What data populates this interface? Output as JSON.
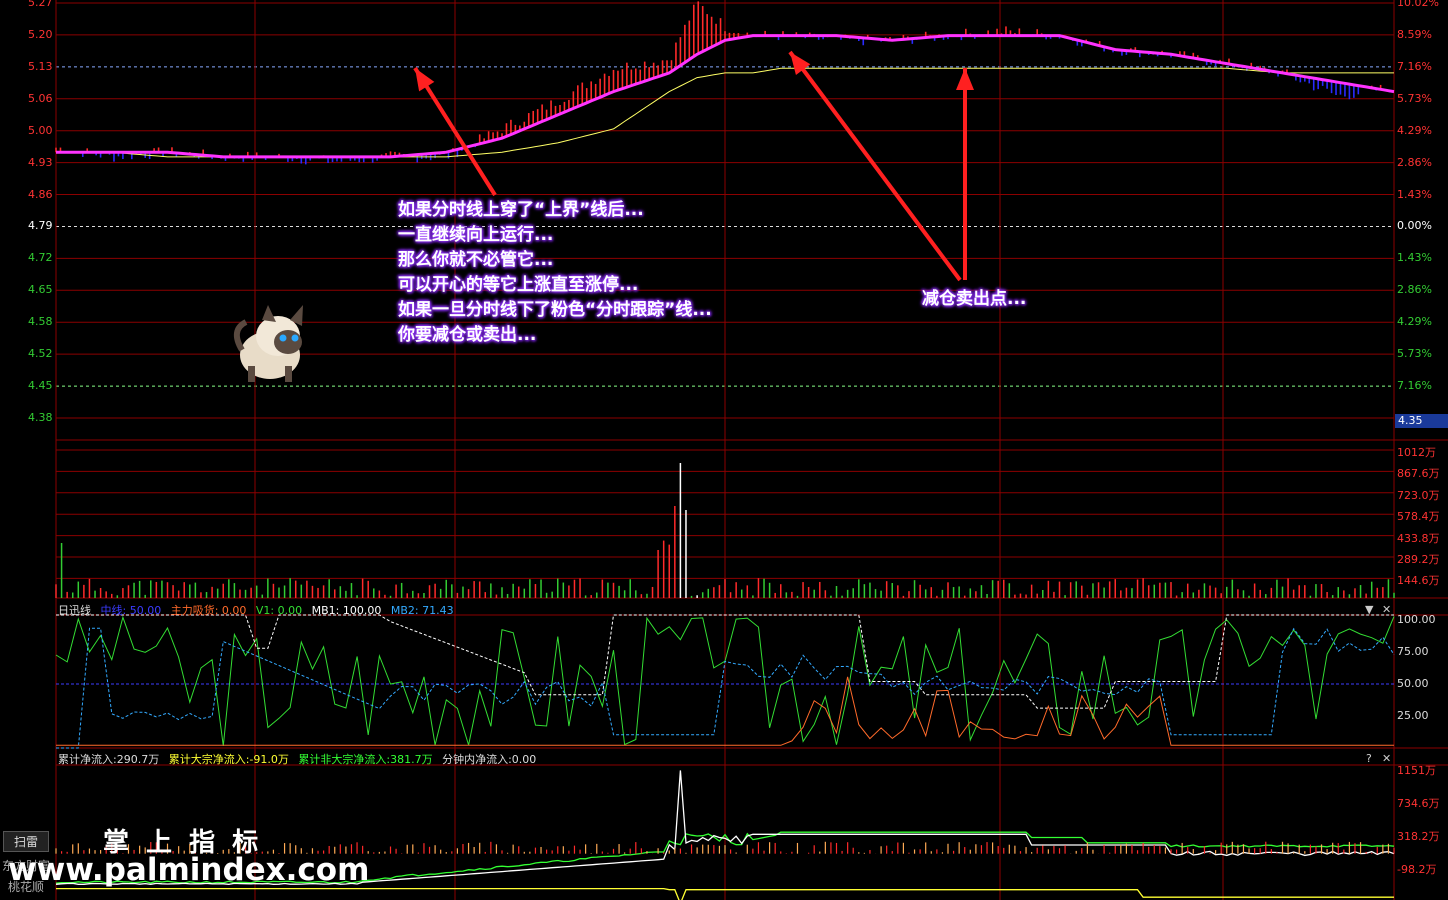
{
  "colors": {
    "up": "#ff2a2a",
    "down": "#2a2aff",
    "price_line": "#ffffff",
    "avg_line": "#ffff66",
    "track_line": "#ff33ff",
    "grid": "#8b0000",
    "green_label": "#33cc33",
    "red_label": "#ff3333",
    "annotation_arrow": "#ff2020"
  },
  "chart_data": [
    {
      "type": "line",
      "panel": "price",
      "ylim": [
        4.38,
        5.27
      ],
      "left_ticks": [
        "5.27",
        "5.20",
        "5.13",
        "5.06",
        "5.00",
        "4.93",
        "4.86",
        "4.79",
        "4.72",
        "4.65",
        "4.58",
        "4.52",
        "4.45",
        "4.38"
      ],
      "right_ticks": [
        "10.02%",
        "8.59%",
        "7.16%",
        "5.73%",
        "4.29%",
        "2.86%",
        "1.43%",
        "0.00%",
        "1.43%",
        "2.86%",
        "4.29%",
        "5.73%",
        "7.16%",
        ""
      ],
      "base_price": 4.79,
      "current_marker": "4.35",
      "x": [
        0,
        10,
        20,
        30,
        40,
        50,
        60,
        70,
        80,
        90,
        100,
        110,
        115,
        120,
        125,
        130,
        140,
        150,
        160,
        170,
        180,
        190,
        200,
        210,
        220,
        230,
        240
      ],
      "series": [
        {
          "key": "price",
          "values": [
            4.96,
            4.94,
            4.95,
            4.94,
            4.94,
            4.93,
            4.94,
            4.94,
            5.0,
            5.06,
            5.13,
            5.15,
            5.27,
            5.22,
            5.2,
            5.2,
            5.19,
            5.19,
            5.2,
            5.21,
            5.2,
            5.17,
            5.16,
            5.14,
            5.12,
            5.07,
            5.09
          ]
        },
        {
          "key": "track",
          "values": [
            4.95,
            4.95,
            4.95,
            4.94,
            4.94,
            4.94,
            4.94,
            4.95,
            4.98,
            5.03,
            5.08,
            5.12,
            5.16,
            5.19,
            5.2,
            5.2,
            5.2,
            5.19,
            5.2,
            5.2,
            5.2,
            5.17,
            5.16,
            5.14,
            5.12,
            5.1,
            5.08
          ]
        },
        {
          "key": "avg",
          "values": [
            4.95,
            4.95,
            4.94,
            4.94,
            4.94,
            4.94,
            4.94,
            4.94,
            4.95,
            4.97,
            5.0,
            5.08,
            5.11,
            5.12,
            5.12,
            5.13,
            5.13,
            5.13,
            5.13,
            5.13,
            5.13,
            5.13,
            5.13,
            5.13,
            5.12,
            5.12,
            5.12
          ]
        }
      ]
    },
    {
      "type": "bar",
      "panel": "volume",
      "ylim": [
        0,
        1200
      ],
      "right_ticks": [
        "1012万",
        "867.6万",
        "723.0万",
        "578.4万",
        "433.8万",
        "289.2万",
        "144.6万"
      ]
    },
    {
      "type": "line",
      "panel": "ri_xun_xian",
      "title": "日迅线",
      "ylim": [
        0,
        100
      ],
      "right_ticks": [
        "100.00",
        "75.00",
        "50.00",
        "25.00"
      ],
      "legend": [
        {
          "label": "中线: 50.00",
          "color": "#3b3bff"
        },
        {
          "label": "主力吸货: 0.00",
          "color": "#ff6a2a"
        },
        {
          "label": "V1: 0.00",
          "color": "#33dd33"
        },
        {
          "label": "MB1: 100.00",
          "color": "#ffffff"
        },
        {
          "label": "MB2: 71.43",
          "color": "#33aaff"
        }
      ]
    },
    {
      "type": "line",
      "panel": "fund_flow",
      "ylim": [
        -98.2,
        1151
      ],
      "right_ticks": [
        "1151万",
        "734.6万",
        "318.2万",
        "-98.2万"
      ],
      "legend": [
        {
          "label": "累计净流入:290.7万",
          "color": "#dddddd"
        },
        {
          "label": "累计大宗净流入:-91.0万",
          "color": "#ffff33"
        },
        {
          "label": "累计非大宗净流入:381.7万",
          "color": "#33ff33"
        },
        {
          "label": "分钟内净流入:0.00",
          "color": "#dddddd"
        }
      ]
    }
  ],
  "annotations": {
    "main": [
      "如果分时线上穿了“上界”线后...",
      "一直继续向上运行...",
      "那么你就不必管它...",
      "可以开心的等它上涨直至涨停...",
      "如果一旦分时线下了粉色“分时跟踪”线...",
      "你要减仓或卖出..."
    ],
    "sell_point": "减仓卖出点..."
  },
  "controls": {
    "dropdown_glyph": "▼",
    "close_glyph": "✕",
    "help_glyph": "?"
  },
  "sidebar": {
    "scan_button": "扫雷",
    "tab_dongfang": "东方财富",
    "tab_tonghuashun": "桃花顺"
  },
  "watermark": {
    "title": "掌 上 指 标",
    "url": "www.palmindex.com"
  }
}
